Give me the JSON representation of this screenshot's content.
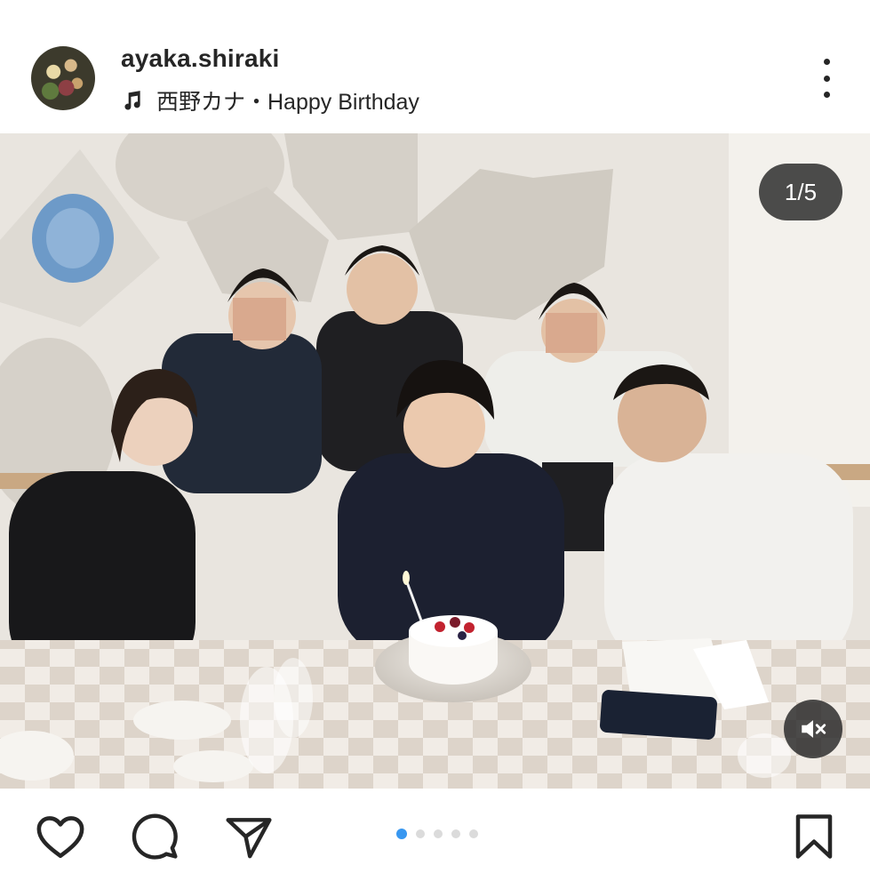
{
  "post": {
    "username": "ayaka.shiraki",
    "music": "西野カナ・Happy Birthday",
    "counter": "1/5",
    "carousel": {
      "current": 1,
      "total": 5
    }
  },
  "icons": {
    "music": "music-note-icon",
    "more": "more-vertical-icon",
    "mute": "speaker-muted-icon",
    "like": "heart-outline-icon",
    "comment": "comment-bubble-icon",
    "share": "paper-plane-icon",
    "save": "bookmark-outline-icon"
  },
  "colors": {
    "text": "#262626",
    "accent": "#3897f0",
    "inactive_dot": "#dbdbdb",
    "overlay": "#262626"
  }
}
